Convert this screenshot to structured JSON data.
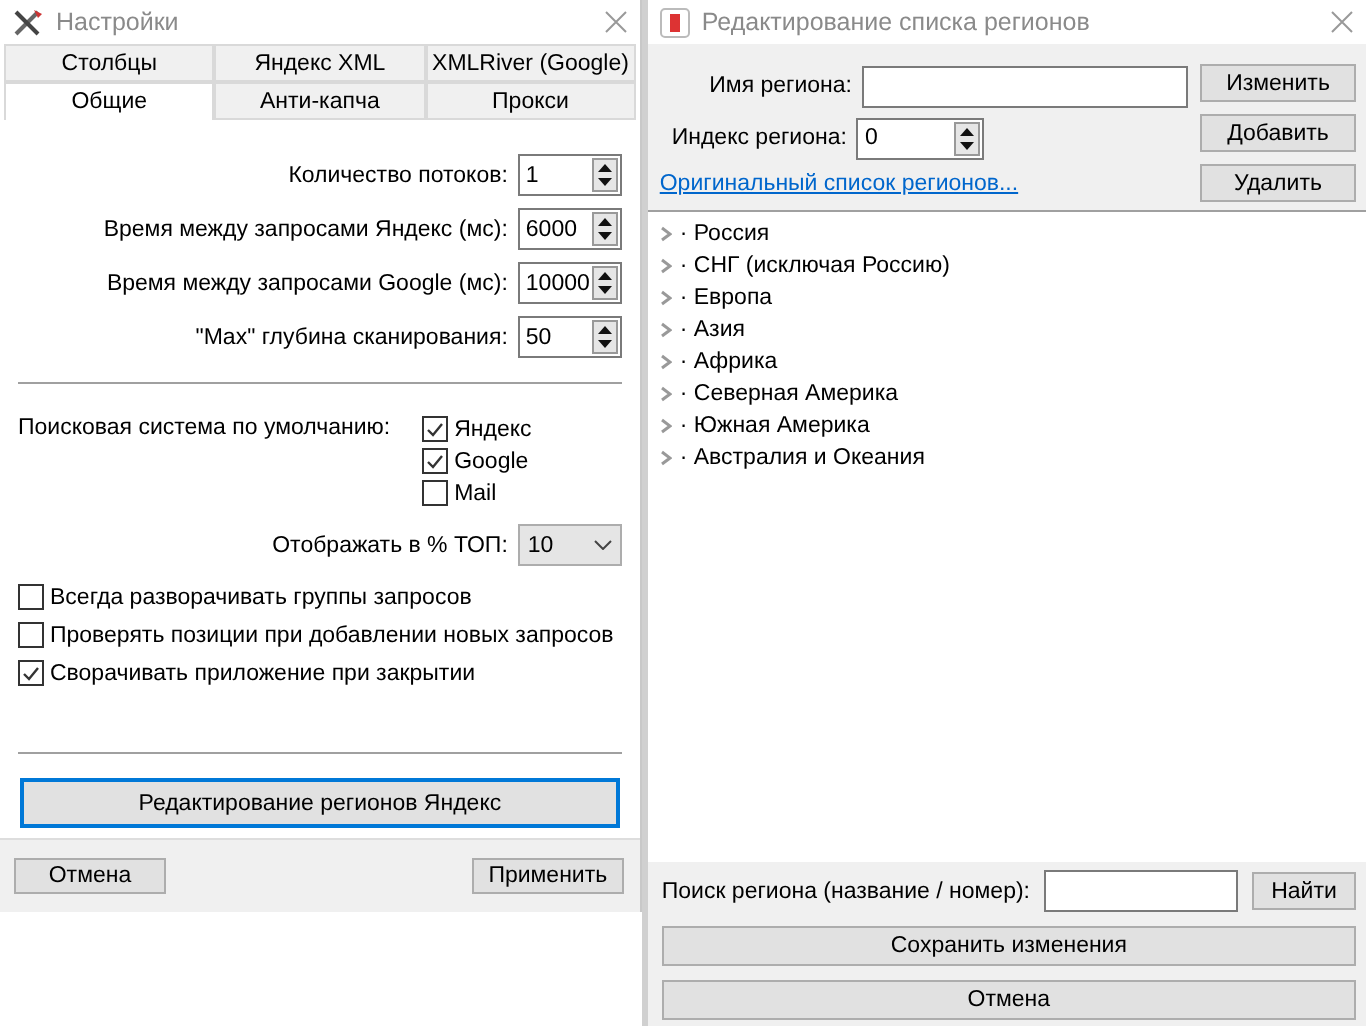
{
  "settings_window": {
    "title": "Настройки",
    "tab_rows": [
      [
        {
          "label": "Столбцы",
          "selected": false
        },
        {
          "label": "Яндекс XML",
          "selected": false
        },
        {
          "label": "XMLRiver (Google)",
          "selected": false
        }
      ],
      [
        {
          "label": "Общие",
          "selected": true
        },
        {
          "label": "Анти-капча",
          "selected": false
        },
        {
          "label": "Прокси",
          "selected": false
        }
      ]
    ],
    "spinners": [
      {
        "label": "Количество потоков:",
        "value": "1"
      },
      {
        "label": "Время между запросами Яндекс (мс):",
        "value": "6000"
      },
      {
        "label": "Время между запросами Google (мс):",
        "value": "10000"
      },
      {
        "label": "\"Max\" глубина сканирования:",
        "value": "50"
      }
    ],
    "search_engine": {
      "label": "Поисковая система по умолчанию:",
      "options": [
        {
          "label": "Яндекс",
          "checked": true
        },
        {
          "label": "Google",
          "checked": true
        },
        {
          "label": "Mail",
          "checked": false
        }
      ]
    },
    "top_select": {
      "label": "Отображать в % ТОП:",
      "value": "10"
    },
    "options": [
      {
        "label": "Всегда разворачивать группы запросов",
        "checked": false
      },
      {
        "label": "Проверять позиции при добавлении новых запросов",
        "checked": false
      },
      {
        "label": "Сворачивать приложение при закрытии",
        "checked": true
      }
    ],
    "regions_button": "Редактирование регионов Яндекс",
    "buttons": [
      "Отмена",
      "Применить"
    ]
  },
  "regions_window": {
    "title": "Редактирование списка регионов",
    "name_field": {
      "label": "Имя региона:"
    },
    "index_field": {
      "label": "Индекс региона:",
      "value": "0"
    },
    "side_buttons": [
      "Изменить",
      "Добавить",
      "Удалить"
    ],
    "link": "Оригинальный список регионов...",
    "tree": [
      {
        "label": "· Россия",
        "expanded": false
      },
      {
        "label": "· СНГ (исключая Россию)",
        "expanded": false
      },
      {
        "label": "· Европа",
        "expanded": false
      },
      {
        "label": "· Азия",
        "expanded": false
      },
      {
        "label": "· Африка",
        "expanded": false
      },
      {
        "label": "· Северная Америка",
        "expanded": false
      },
      {
        "label": "· Южная Америка",
        "expanded": false
      },
      {
        "label": "· Австралия и Океания",
        "expanded": false
      }
    ],
    "search": {
      "label": "Поиск региона (название / номер):",
      "button": "Найти"
    },
    "save_button": "Сохранить изменения",
    "cancel_button": "Отмена"
  }
}
